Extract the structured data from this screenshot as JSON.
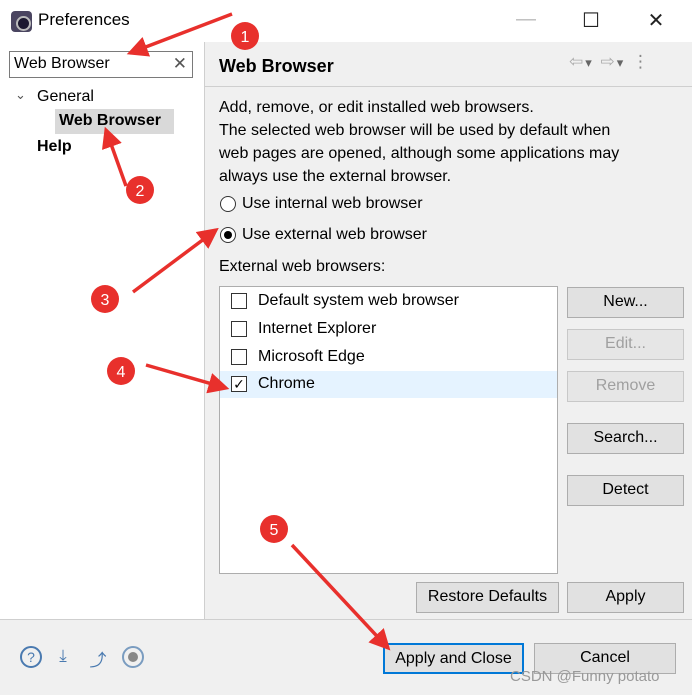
{
  "window": {
    "title": "Preferences",
    "minimize": "—",
    "maximize": "☐",
    "close": "✕"
  },
  "sidebar": {
    "search_value": "Web Browser",
    "clear": "✕",
    "tree": [
      {
        "label": "General",
        "expanded": true
      },
      {
        "label": "Web Browser",
        "selected": true
      },
      {
        "label": "Help"
      }
    ]
  },
  "page": {
    "title": "Web Browser",
    "nav": {
      "back": "⇦",
      "back_menu": "▾",
      "forward": "⇨",
      "forward_menu": "▾",
      "more": "⋮"
    },
    "description": [
      "Add, remove, or edit installed web browsers.",
      "The selected web browser will be used by default when",
      "web pages are opened, although some applications may",
      "always use the external browser."
    ],
    "radio_internal": "Use internal web browser",
    "radio_external": "Use external web browser",
    "selected_radio": "external",
    "list_label": "External web browsers:",
    "browsers": [
      {
        "label": "Default system web browser",
        "checked": false
      },
      {
        "label": "Internet Explorer",
        "checked": false
      },
      {
        "label": "Microsoft Edge",
        "checked": false
      },
      {
        "label": "Chrome",
        "checked": true
      }
    ],
    "buttons": {
      "new": "New...",
      "edit": "Edit...",
      "remove": "Remove",
      "search": "Search...",
      "detect": "Detect",
      "restore": "Restore Defaults",
      "apply": "Apply"
    }
  },
  "footer": {
    "apply_close": "Apply and Close",
    "cancel": "Cancel"
  },
  "annotations": [
    "1",
    "2",
    "3",
    "4",
    "5"
  ],
  "watermark": "CSDN @Funny potato",
  "colors": {
    "annotation": "#e8302c",
    "focus": "#0078d7",
    "selection": "#cce8ff"
  }
}
